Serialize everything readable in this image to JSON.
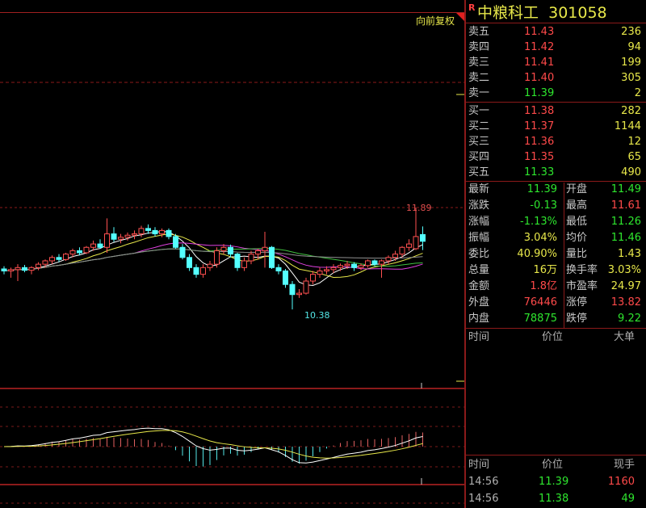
{
  "chart": {
    "adjust_label": "向前复权",
    "high_label": "11.89",
    "low_label": "10.38",
    "kline": [
      [
        10.98,
        11.02,
        10.9,
        10.95
      ],
      [
        10.95,
        11.0,
        10.85,
        10.97
      ],
      [
        10.97,
        11.05,
        10.8,
        11.0
      ],
      [
        11.0,
        11.04,
        10.93,
        10.96
      ],
      [
        10.96,
        11.02,
        10.9,
        11.0
      ],
      [
        11.0,
        11.08,
        10.96,
        11.05
      ],
      [
        11.05,
        11.12,
        11.0,
        11.1
      ],
      [
        11.1,
        11.18,
        11.05,
        11.15
      ],
      [
        11.15,
        11.2,
        11.08,
        11.12
      ],
      [
        11.12,
        11.22,
        11.1,
        11.2
      ],
      [
        11.2,
        11.28,
        11.15,
        11.25
      ],
      [
        11.25,
        11.3,
        11.18,
        11.22
      ],
      [
        11.22,
        11.32,
        11.2,
        11.3
      ],
      [
        11.3,
        11.4,
        11.25,
        11.35
      ],
      [
        11.35,
        11.42,
        11.28,
        11.3
      ],
      [
        11.3,
        11.73,
        11.22,
        11.5
      ],
      [
        11.5,
        11.6,
        11.38,
        11.42
      ],
      [
        11.42,
        11.5,
        11.36,
        11.45
      ],
      [
        11.45,
        11.52,
        11.4,
        11.48
      ],
      [
        11.48,
        11.55,
        11.42,
        11.5
      ],
      [
        11.5,
        11.62,
        11.45,
        11.58
      ],
      [
        11.58,
        11.64,
        11.5,
        11.55
      ],
      [
        11.55,
        11.6,
        11.46,
        11.5
      ],
      [
        11.5,
        11.58,
        11.45,
        11.55
      ],
      [
        11.55,
        11.58,
        11.42,
        11.46
      ],
      [
        11.46,
        11.5,
        11.28,
        11.3
      ],
      [
        11.3,
        11.35,
        11.12,
        11.15
      ],
      [
        11.15,
        11.2,
        10.95,
        11.0
      ],
      [
        11.0,
        11.05,
        10.85,
        10.9
      ],
      [
        10.9,
        11.05,
        10.85,
        11.0
      ],
      [
        11.0,
        11.1,
        10.95,
        11.05
      ],
      [
        11.05,
        11.3,
        11.0,
        11.25
      ],
      [
        11.25,
        11.35,
        11.2,
        11.3
      ],
      [
        11.3,
        11.34,
        11.15,
        11.2
      ],
      [
        11.2,
        11.22,
        10.95,
        11.0
      ],
      [
        11.0,
        11.15,
        10.95,
        11.1
      ],
      [
        11.1,
        11.25,
        11.05,
        11.2
      ],
      [
        11.2,
        11.28,
        11.12,
        11.25
      ],
      [
        11.25,
        11.53,
        11.0,
        11.3
      ],
      [
        11.3,
        11.32,
        10.98,
        11.0
      ],
      [
        11.0,
        11.05,
        10.9,
        10.95
      ],
      [
        10.95,
        10.98,
        10.7,
        10.75
      ],
      [
        10.75,
        10.8,
        10.38,
        10.6
      ],
      [
        10.6,
        10.68,
        10.55,
        10.62
      ],
      [
        10.62,
        10.85,
        10.6,
        10.8
      ],
      [
        10.8,
        10.95,
        10.75,
        10.9
      ],
      [
        10.9,
        11.0,
        10.85,
        10.95
      ],
      [
        10.95,
        11.02,
        10.9,
        10.97
      ],
      [
        10.97,
        11.05,
        10.92,
        11.0
      ],
      [
        11.0,
        11.06,
        10.95,
        11.03
      ],
      [
        11.03,
        11.1,
        10.98,
        11.05
      ],
      [
        11.05,
        11.08,
        10.95,
        11.0
      ],
      [
        11.0,
        11.06,
        10.96,
        11.03
      ],
      [
        11.03,
        11.12,
        11.0,
        11.1
      ],
      [
        11.1,
        11.12,
        11.02,
        11.05
      ],
      [
        11.05,
        11.12,
        10.85,
        11.1
      ],
      [
        11.1,
        11.18,
        11.05,
        11.15
      ],
      [
        11.15,
        11.25,
        11.1,
        11.2
      ],
      [
        11.2,
        11.32,
        11.15,
        11.3
      ],
      [
        11.3,
        11.42,
        11.25,
        11.35
      ],
      [
        11.28,
        11.89,
        11.26,
        11.46
      ],
      [
        11.49,
        11.61,
        11.26,
        11.39
      ]
    ]
  },
  "panel": {
    "r_badge": "R",
    "stock_name": "中粮科工",
    "stock_code": "301058",
    "asks": [
      {
        "label": "卖五",
        "price": "11.43",
        "vol": "236",
        "c": "red"
      },
      {
        "label": "卖四",
        "price": "11.42",
        "vol": "94",
        "c": "red"
      },
      {
        "label": "卖三",
        "price": "11.41",
        "vol": "199",
        "c": "red"
      },
      {
        "label": "卖二",
        "price": "11.40",
        "vol": "305",
        "c": "red"
      },
      {
        "label": "卖一",
        "price": "11.39",
        "vol": "2",
        "c": "grn"
      }
    ],
    "bids": [
      {
        "label": "买一",
        "price": "11.38",
        "vol": "282",
        "c": "red"
      },
      {
        "label": "买二",
        "price": "11.37",
        "vol": "1144",
        "c": "red"
      },
      {
        "label": "买三",
        "price": "11.36",
        "vol": "12",
        "c": "red"
      },
      {
        "label": "买四",
        "price": "11.35",
        "vol": "65",
        "c": "red"
      },
      {
        "label": "买五",
        "price": "11.33",
        "vol": "490",
        "c": "grn"
      }
    ],
    "stats_left": [
      {
        "k": "最新",
        "v": "11.39",
        "c": "grn"
      },
      {
        "k": "涨跌",
        "v": "-0.13",
        "c": "grn"
      },
      {
        "k": "涨幅",
        "v": "-1.13%",
        "c": "grn"
      },
      {
        "k": "振幅",
        "v": "3.04%",
        "c": "yel"
      },
      {
        "k": "委比",
        "v": "40.90%",
        "c": "yel"
      },
      {
        "k": "总量",
        "v": "16万",
        "c": "yel"
      },
      {
        "k": "金额",
        "v": "1.8亿",
        "c": "red"
      },
      {
        "k": "外盘",
        "v": "76446",
        "c": "red"
      },
      {
        "k": "内盘",
        "v": "78875",
        "c": "grn"
      }
    ],
    "stats_right": [
      {
        "k": "开盘",
        "v": "11.49",
        "c": "grn"
      },
      {
        "k": "最高",
        "v": "11.61",
        "c": "red"
      },
      {
        "k": "最低",
        "v": "11.26",
        "c": "grn"
      },
      {
        "k": "均价",
        "v": "11.46",
        "c": "grn"
      },
      {
        "k": "量比",
        "v": "1.43",
        "c": "yel"
      },
      {
        "k": "换手率",
        "v": "3.03%",
        "c": "yel"
      },
      {
        "k": "市盈率",
        "v": "24.97",
        "c": "yel"
      },
      {
        "k": "涨停",
        "v": "13.82",
        "c": "red"
      },
      {
        "k": "跌停",
        "v": "9.22",
        "c": "grn"
      }
    ],
    "big_header": {
      "time": "时间",
      "price": "价位",
      "big": "大单"
    },
    "ticks_header": {
      "time": "时间",
      "price": "价位",
      "vol": "现手"
    },
    "ticks": [
      {
        "time": "14:56",
        "price": "11.39",
        "vol": "1160",
        "vc": "red"
      },
      {
        "time": "14:56",
        "price": "11.38",
        "vol": "49",
        "vc": "grn"
      }
    ]
  }
}
